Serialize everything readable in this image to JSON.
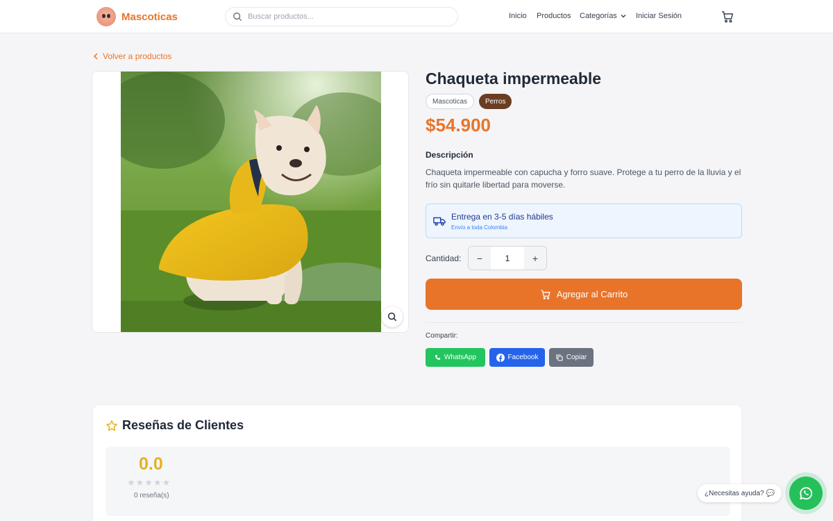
{
  "header": {
    "brand": "Mascoticas",
    "search_placeholder": "Buscar productos...",
    "nav": [
      "Inicio",
      "Productos",
      "Categorías",
      "Iniciar Sesión"
    ]
  },
  "back_link": "Volver a productos",
  "product": {
    "title": "Chaqueta impermeable",
    "tags": [
      "Mascoticas",
      "Perros"
    ],
    "price": "$54.900",
    "description_heading": "Descripción",
    "description": "Chaqueta impermeable con capucha y forro suave. Protege a tu perro de la lluvia y el frío sin quitarle libertad para moverse.",
    "delivery_title": "Entrega en 3-5 días hábiles",
    "delivery_subtitle": "Envío a toda Colombia",
    "quantity_label": "Cantidad:",
    "quantity_value": "1",
    "quantity_minus": "−",
    "quantity_plus": "+",
    "add_to_cart": "Agregar al Carrito",
    "share_label": "Compartir:",
    "share_buttons": [
      "WhatsApp",
      "Facebook",
      "Copiar"
    ]
  },
  "reviews": {
    "title": "Reseñas de Clientes",
    "score": "0.0",
    "stars": "★★★★★",
    "rating_fraction": 0,
    "count": "0 reseña(s)"
  },
  "help": {
    "bubble": "¿Necesitas ayuda?",
    "bubble_emoji": "💬"
  },
  "colors": {
    "accent": "#e8742a",
    "tag_dark": "#6b3e24",
    "whatsapp": "#22c55e",
    "facebook": "#2563eb",
    "copy": "#6b7280",
    "star": "#e6b022"
  }
}
